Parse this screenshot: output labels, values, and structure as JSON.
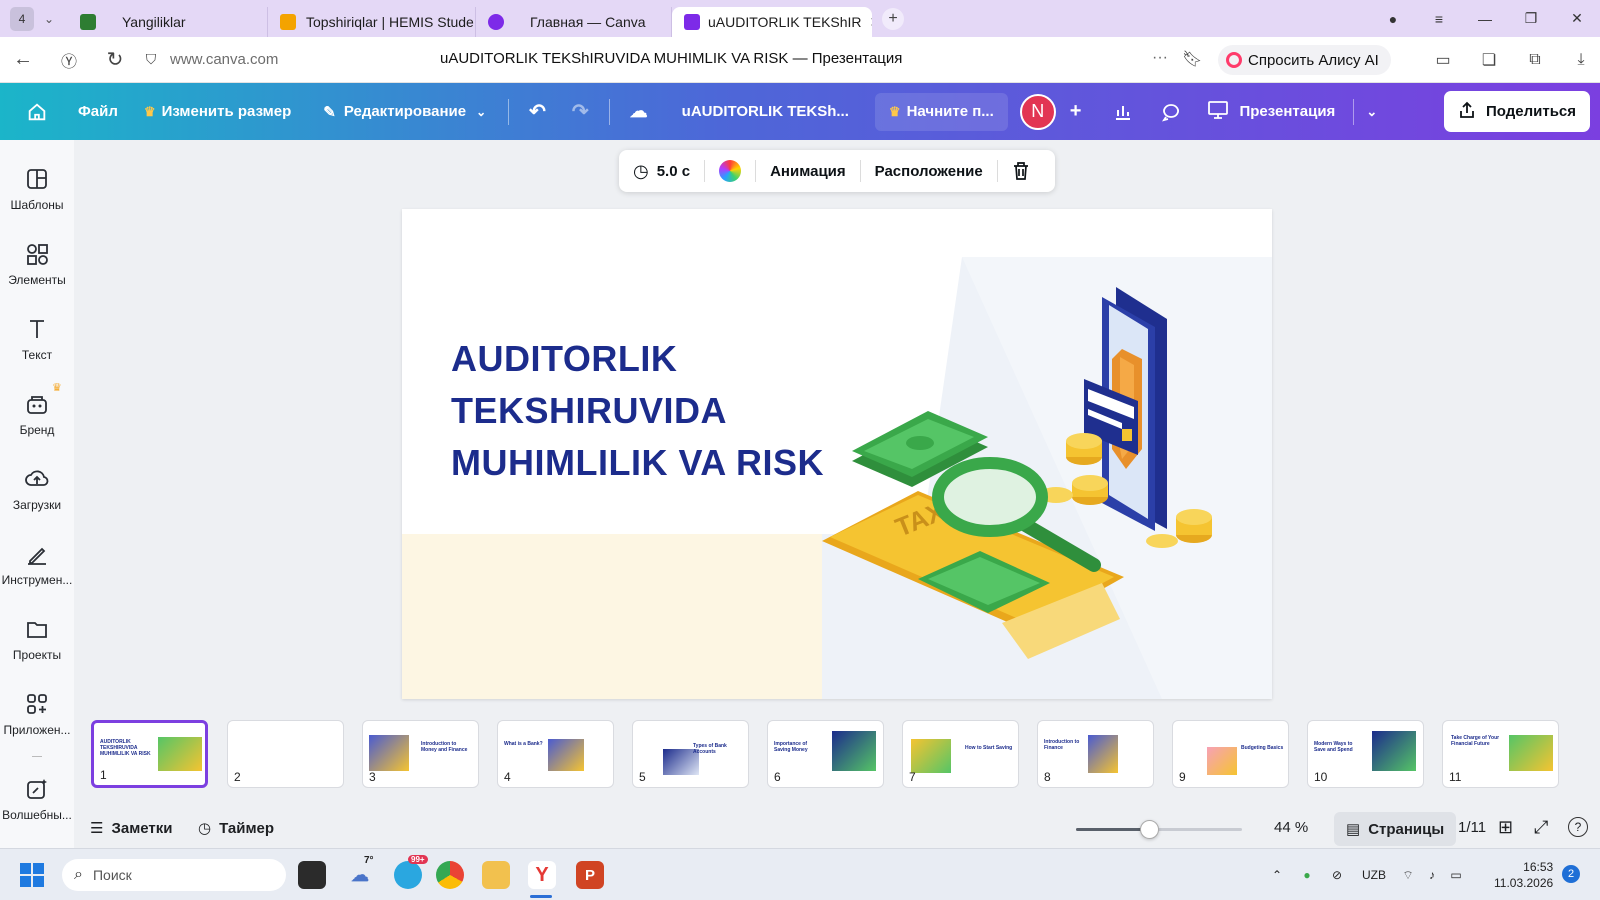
{
  "browser": {
    "tab_count": "4",
    "tabs": [
      {
        "title": "Yangiliklar",
        "favicon_color": "#2e7d32"
      },
      {
        "title": "Topshiriqlar | HEMIS Stude",
        "favicon_color": "#f4a300"
      },
      {
        "title": "Главная — Canva",
        "favicon_color": "#7d2ae8"
      },
      {
        "title": "uAUDITORLIK TEKShIR",
        "favicon_color": "#7d2ae8",
        "active": true
      }
    ],
    "url": "www.canva.com",
    "page_title": "uAUDITORLIK TEKShIRUVIDA MUHIMLIK VA RISK — Презентация",
    "alice_label": "Спросить Алису AI"
  },
  "canva_toolbar": {
    "file": "Файл",
    "resize": "Изменить размер",
    "editing": "Редактирование",
    "doc_title": "uAUDITORLIK TEKSh...",
    "start": "Начните п...",
    "avatar_letter": "N",
    "present": "Презентация",
    "share": "Поделиться"
  },
  "sidebar": {
    "items": [
      {
        "label": "Шаблоны",
        "icon": "templates-icon"
      },
      {
        "label": "Элементы",
        "icon": "elements-icon"
      },
      {
        "label": "Текст",
        "icon": "text-icon"
      },
      {
        "label": "Бренд",
        "icon": "brand-icon"
      },
      {
        "label": "Загрузки",
        "icon": "uploads-icon"
      },
      {
        "label": "Инструмен...",
        "icon": "tools-icon"
      },
      {
        "label": "Проекты",
        "icon": "projects-icon"
      },
      {
        "label": "Приложен...",
        "icon": "apps-icon"
      },
      {
        "label": "Волшебны...",
        "icon": "magic-icon"
      }
    ]
  },
  "element_toolbar": {
    "duration": "5.0 с",
    "animation": "Анимация",
    "position": "Расположение"
  },
  "slide": {
    "title_lines": [
      "AUDITORLIK",
      "TEKSHIRUVIDA",
      "MUHIMLILIK VA RISK"
    ],
    "illustration_text": "TAX",
    "colors": {
      "title": "#1c2c8c",
      "phone": "#1f2f8f",
      "money": "#3aa84a",
      "gold": "#f5c431"
    }
  },
  "thumbnails": [
    {
      "num": "1",
      "title": "AUDITORLIK TEKSHIRUVIDA MUHIMLILIK VA RISK",
      "selected": true
    },
    {
      "num": "2",
      "title": ""
    },
    {
      "num": "3",
      "title": "Introduction to Money and Finance"
    },
    {
      "num": "4",
      "title": "What is a Bank?"
    },
    {
      "num": "5",
      "title": "Types of Bank Accounts"
    },
    {
      "num": "6",
      "title": "Importance of Saving Money"
    },
    {
      "num": "7",
      "title": "How to Start Saving"
    },
    {
      "num": "8",
      "title": "Introduction to Finance"
    },
    {
      "num": "9",
      "title": "Budgeting Basics"
    },
    {
      "num": "10",
      "title": "Modern Ways to Save and Spend"
    },
    {
      "num": "11",
      "title": "Take Charge of Your Financial Future"
    }
  ],
  "bottom_bar": {
    "notes": "Заметки",
    "timer": "Таймер",
    "zoom": "44 %",
    "zoom_value": 0.44,
    "pages": "Страницы",
    "page_counter": "1/11"
  },
  "taskbar": {
    "search_placeholder": "Поиск",
    "weather": "7°",
    "badge": "99+",
    "lang": "UZB",
    "time": "16:53",
    "date": "11.03.2026",
    "notif": "2"
  }
}
